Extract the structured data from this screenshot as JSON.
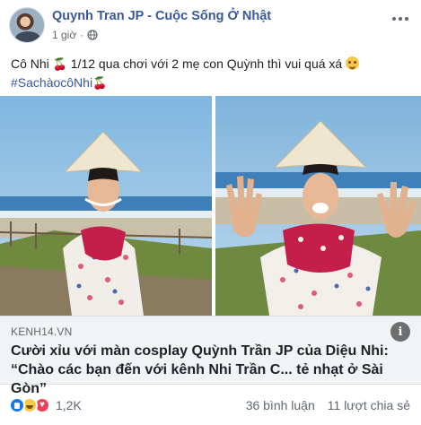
{
  "header": {
    "page_name": "Quynh Tran JP - Cuộc Sống Ở Nhật",
    "time": "1 giờ",
    "separator": "·"
  },
  "post": {
    "line1_a": "Cô Nhi ",
    "line1_b": " 1/12 qua chơi với 2 mẹ con Quỳnh thì vui quá xá ",
    "hashtag": "#SachàocôNhi",
    "cherry": "🍒"
  },
  "link": {
    "domain": "KENH14.VN",
    "title": "Cười xỉu với màn cosplay Quỳnh Trần JP của Diệu Nhi: “Chào các bạn đến với kênh Nhi Trần C... tẻ nhạt ở Sài Gòn”",
    "info_icon": "i"
  },
  "footer": {
    "reaction_count": "1,2K",
    "comments": "36 bình luận",
    "shares": "11 lượt chia sẻ"
  },
  "icons": [
    "globe-icon",
    "more-icon",
    "info-icon",
    "like-icon",
    "haha-icon",
    "love-icon",
    "smiling-face-hearts-icon",
    "cherry-icon"
  ],
  "colors": {
    "link_blue": "#385898",
    "meta_gray": "#606770",
    "like_blue": "#1877f2",
    "love_red": "#f33e58",
    "haha_yellow": "#f7c948"
  }
}
